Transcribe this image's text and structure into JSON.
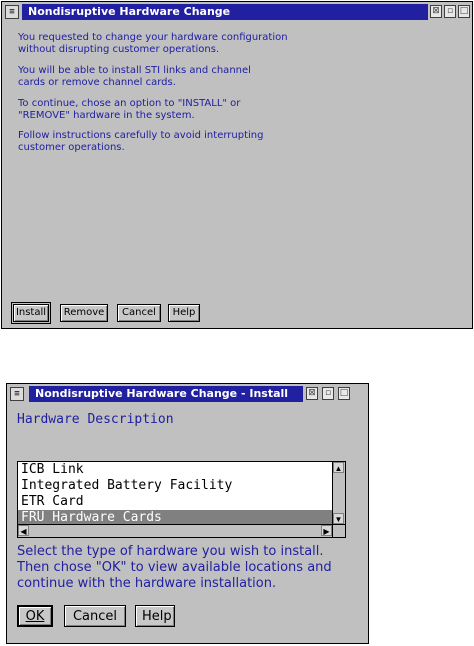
{
  "window1": {
    "title": "Nondisruptive Hardware Change",
    "paragraphs": [
      "You requested to change your hardware configuration without disrupting customer operations.",
      "You will be able to install STI links and channel cards or remove channel cards.",
      "To continue, chose an option to \"INSTALL\" or \"REMOVE\" hardware in the system.",
      "Follow instructions carefully to avoid interrupting customer operations."
    ],
    "buttons": {
      "install": "Install",
      "remove": "Remove",
      "cancel": "Cancel",
      "help": "Help"
    }
  },
  "window2": {
    "title": "Nondisruptive Hardware Change - Install",
    "heading": "Hardware Description",
    "list_items": [
      "ICB Link",
      "Integrated Battery Facility",
      "ETR Card",
      "FRU Hardware Cards"
    ],
    "selected_item": "FRU Hardware Cards",
    "instructions": "Select the type of hardware you wish to install. Then chose \"OK\" to view available locations and continue with the hardware installation.",
    "buttons": {
      "ok": "OK",
      "cancel": "Cancel",
      "help": "Help"
    }
  },
  "icons": [
    "system-menu-icon",
    "hide-icon",
    "minimize-icon",
    "maximize-icon",
    "scroll-up-icon",
    "scroll-down-icon",
    "scroll-left-icon",
    "scroll-right-icon"
  ],
  "colors": {
    "title_bar": "#2020a0",
    "text": "#2020a0",
    "window_bg": "#c0c0c0",
    "selection": "#808080"
  }
}
